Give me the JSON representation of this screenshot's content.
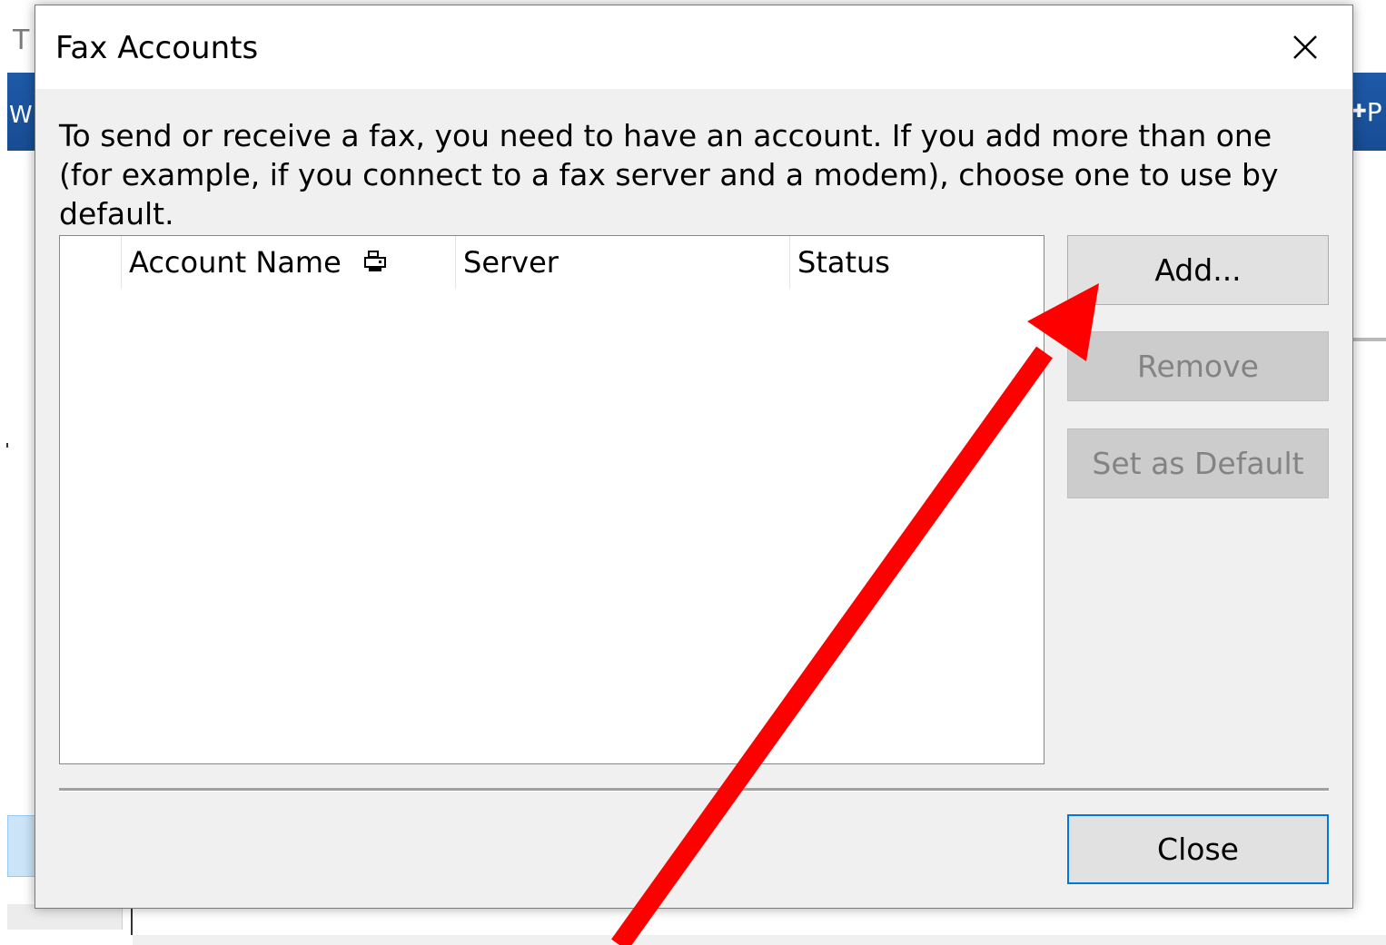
{
  "background": {
    "title_fragment": "T",
    "blue_left_fragment": "W",
    "blue_right_fragment": "P"
  },
  "dialog": {
    "title": "Fax Accounts",
    "description": "To send or receive a fax, you need to have an account. If you add more than one (for example, if you connect to a fax server and a modem), choose one to use by default.",
    "columns": [
      "",
      "Account Name",
      "Server",
      "Status"
    ],
    "sort_icon": "sort-indicator-icon",
    "rows": [],
    "buttons": {
      "add": "Add...",
      "remove": "Remove",
      "set_default": "Set as Default",
      "close": "Close"
    },
    "colors": {
      "focus_border": "#0078d7",
      "annotation_arrow": "#ff0000"
    }
  }
}
